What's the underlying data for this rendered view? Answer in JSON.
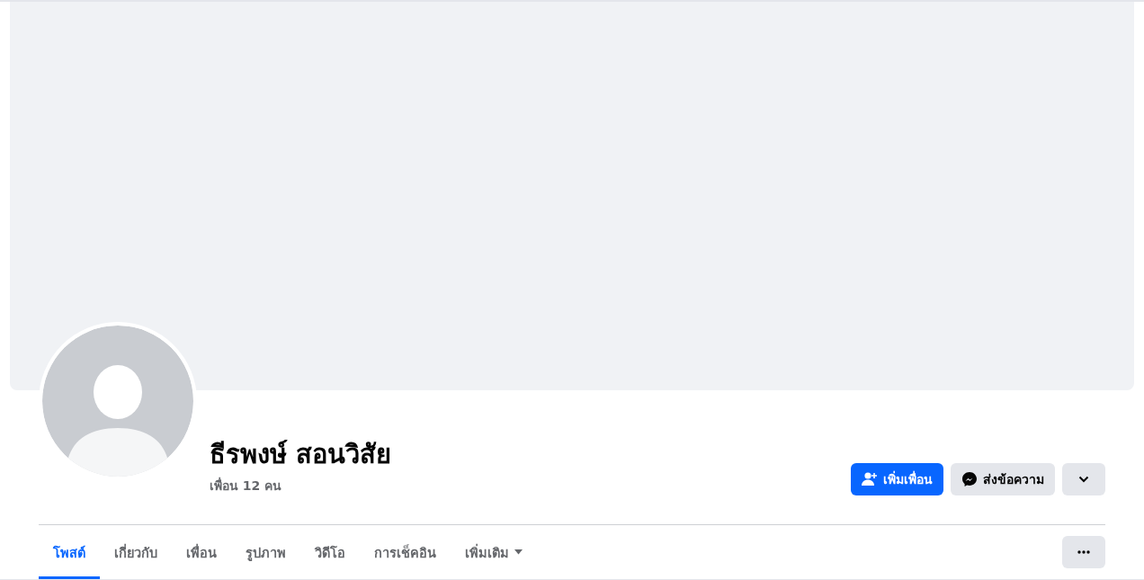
{
  "profile": {
    "name": "ธีรพงษ์ สอนวิสัย",
    "friends": "เพื่อน 12 คน"
  },
  "actions": [
    {
      "label": "เพิ่มเพื่อน",
      "kind": "primary"
    },
    {
      "label": "ส่งข้อความ",
      "kind": "message"
    },
    {
      "kind": "dropdown"
    }
  ],
  "tabs": [
    {
      "label": "โพสต์",
      "selected": true
    },
    {
      "label": "เกี่ยวกับ",
      "selected": false
    },
    {
      "label": "เพื่อน",
      "selected": false
    },
    {
      "label": "รูปภาพ",
      "selected": false
    },
    {
      "label": "วิดีโอ",
      "selected": false
    },
    {
      "label": "การเช็คอิน",
      "selected": false
    },
    {
      "label": "เพิ่มเติม",
      "selected": false,
      "kind": "more"
    }
  ]
}
